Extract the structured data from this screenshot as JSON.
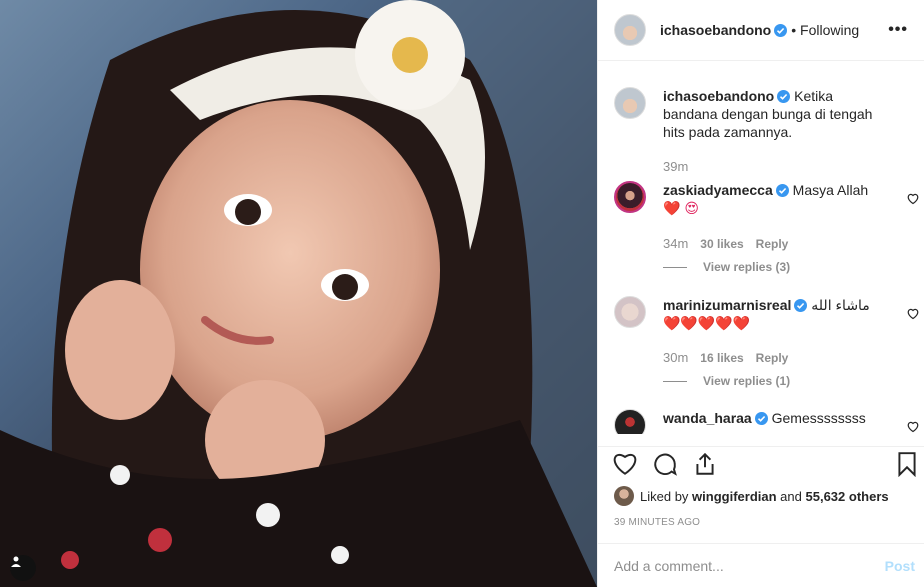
{
  "post": {
    "author": "ichasoebandono",
    "following_label": "Following",
    "more_label": "•••",
    "caption": "Ketika bandana dengan bunga di tengah hits pada zamannya.",
    "caption_time": "39m"
  },
  "comments": [
    {
      "user": "zaskiadyamecca",
      "text": "Masya Allah",
      "emoji": "❤️ 😍",
      "time": "34m",
      "likes": "30 likes",
      "reply": "Reply",
      "view_replies": "View replies (3)"
    },
    {
      "user": "marinizumarnisreal",
      "text": "ماشاء الله",
      "emoji": "❤️❤️❤️❤️❤️",
      "time": "30m",
      "likes": "16 likes",
      "reply": "Reply",
      "view_replies": "View replies (1)"
    },
    {
      "user": "wanda_haraa",
      "text": "Gemessssssss"
    }
  ],
  "likes": {
    "prefix": "Liked by",
    "user": "winggiferdian",
    "and": "and",
    "count": "55,632 others"
  },
  "timestamp": "39 MINUTES AGO",
  "add_comment": {
    "placeholder": "Add a comment...",
    "post_label": "Post"
  },
  "colors": {
    "verified": "#3897f0",
    "heart": "#e0245e",
    "muted": "#8e8e8e"
  }
}
